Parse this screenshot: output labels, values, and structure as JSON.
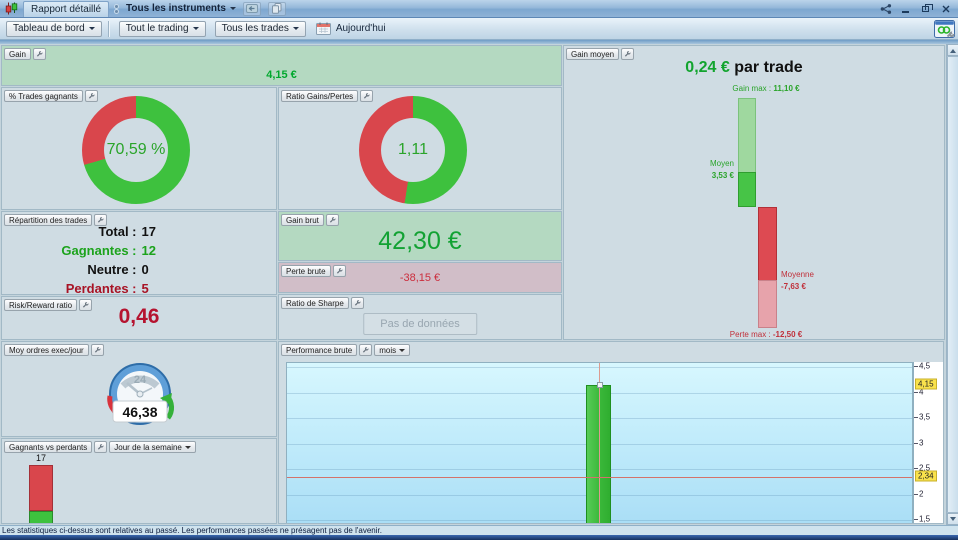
{
  "titlebar": {
    "report_tab": "Rapport détaillé",
    "instruments_dropdown": "Tous les instruments"
  },
  "toolbar": {
    "dashboard_dropdown": "Tableau de bord",
    "trading_scope_dropdown": "Tout le trading",
    "trades_filter_dropdown": "Tous les trades",
    "period_label": "Aujourd'hui"
  },
  "panels": {
    "gain": {
      "label": "Gain",
      "value": "4,15 €"
    },
    "pct_trades_gagnants": {
      "label": "% Trades gagnants",
      "value": "70,59 %"
    },
    "ratio_gains_pertes": {
      "label": "Ratio Gains/Pertes",
      "value": "1,11"
    },
    "gain_moyen": {
      "label": "Gain moyen",
      "value": "0,24 €",
      "suffix": "par trade",
      "gain_max_label": "Gain max :",
      "gain_max": "11,10 €",
      "moyen_label": "Moyen",
      "moyen": "3,53 €",
      "moyenne_label": "Moyenne",
      "moyenne": "-7,63 €",
      "perte_max_label": "Perte max :",
      "perte_max": "-12,50 €"
    },
    "repartition_des_trades": {
      "label": "Répartition des trades",
      "rows": [
        {
          "label": "Total :",
          "value": "17"
        },
        {
          "label": "Gagnantes :",
          "value": "12"
        },
        {
          "label": "Neutre :",
          "value": "0"
        },
        {
          "label": "Perdantes :",
          "value": "5"
        }
      ]
    },
    "gain_brut": {
      "label": "Gain brut",
      "value": "42,30 €"
    },
    "perte_brute": {
      "label": "Perte brute",
      "value": "-38,15 €"
    },
    "risk_reward": {
      "label": "Risk/Reward ratio",
      "value": "0,46"
    },
    "ratio_de_sharpe": {
      "label": "Ratio de Sharpe",
      "empty_button": "Pas de données"
    },
    "moy_ordres_exec_jour": {
      "label": "Moy ordres exec/jour",
      "value": "46,38",
      "clock_label": "24"
    },
    "gagnants_vs_perdants": {
      "label": "Gagnants vs perdants",
      "dropdown": "Jour de la semaine",
      "bar_label": "17"
    },
    "performance_brute": {
      "label": "Performance brute",
      "dropdown": "mois"
    }
  },
  "statusbar": {
    "text": "Les statistiques ci-dessus sont relatives au passé. Les performances passées ne présagent pas de l'avenir."
  },
  "colors": {
    "positive_green": "#12a233",
    "negative_red": "#b5132f",
    "donut_green": "#3ec13e",
    "donut_red": "#d9464c",
    "panel_green_bg": "#b4d9c1",
    "panel_pink_bg": "#d1bec8",
    "panel_bg": "#cfdce3",
    "highlight_yellow": "#f9e24c",
    "crosshair_red": "#d4726a"
  },
  "chart_data": [
    {
      "name": "pct_trades_gagnants",
      "type": "pie",
      "title": "% Trades gagnants",
      "center_label": "70,59 %",
      "slices": [
        {
          "label": "gagnants",
          "value": 70.59,
          "color": "#3ec13e"
        },
        {
          "label": "perdants",
          "value": 29.41,
          "color": "#d9464c"
        }
      ]
    },
    {
      "name": "ratio_gains_pertes",
      "type": "pie",
      "title": "Ratio Gains/Pertes",
      "center_label": "1,11",
      "slices": [
        {
          "label": "gains",
          "value": 52.6,
          "color": "#3ec13e"
        },
        {
          "label": "pertes",
          "value": 47.4,
          "color": "#d9464c"
        }
      ]
    },
    {
      "name": "gain_moyen",
      "type": "bar",
      "title": "0,24 € par trade",
      "bars": [
        {
          "label": "Gain max",
          "value": 11.1,
          "color": "#9fd89f"
        },
        {
          "label": "Moyen",
          "value": 3.53,
          "color": "#47c447"
        },
        {
          "label": "Moyenne",
          "value": -7.63,
          "color": "#dd4a52"
        },
        {
          "label": "Perte max",
          "value": -12.5,
          "color": "#e7a3ab"
        }
      ]
    },
    {
      "name": "gagnants_vs_perdants",
      "type": "bar",
      "stacked": true,
      "period_dropdown": "Jour de la semaine",
      "bar_total": 17,
      "segments": [
        {
          "name": "perdants",
          "color": "#d9464c"
        },
        {
          "name": "gagnants",
          "color": "#3ec13e"
        }
      ]
    },
    {
      "name": "performance_brute",
      "type": "bar",
      "period_dropdown": "mois",
      "values": [
        4.15
      ],
      "reference_line": 2.34,
      "ylim_visible": [
        1.5,
        4.5
      ],
      "ytick_labels": [
        "4,5",
        "4",
        "3,5",
        "3",
        "2,5",
        "2",
        "1,5"
      ],
      "highlight_labels": [
        "4,15",
        "2,34"
      ],
      "grid": true
    }
  ]
}
